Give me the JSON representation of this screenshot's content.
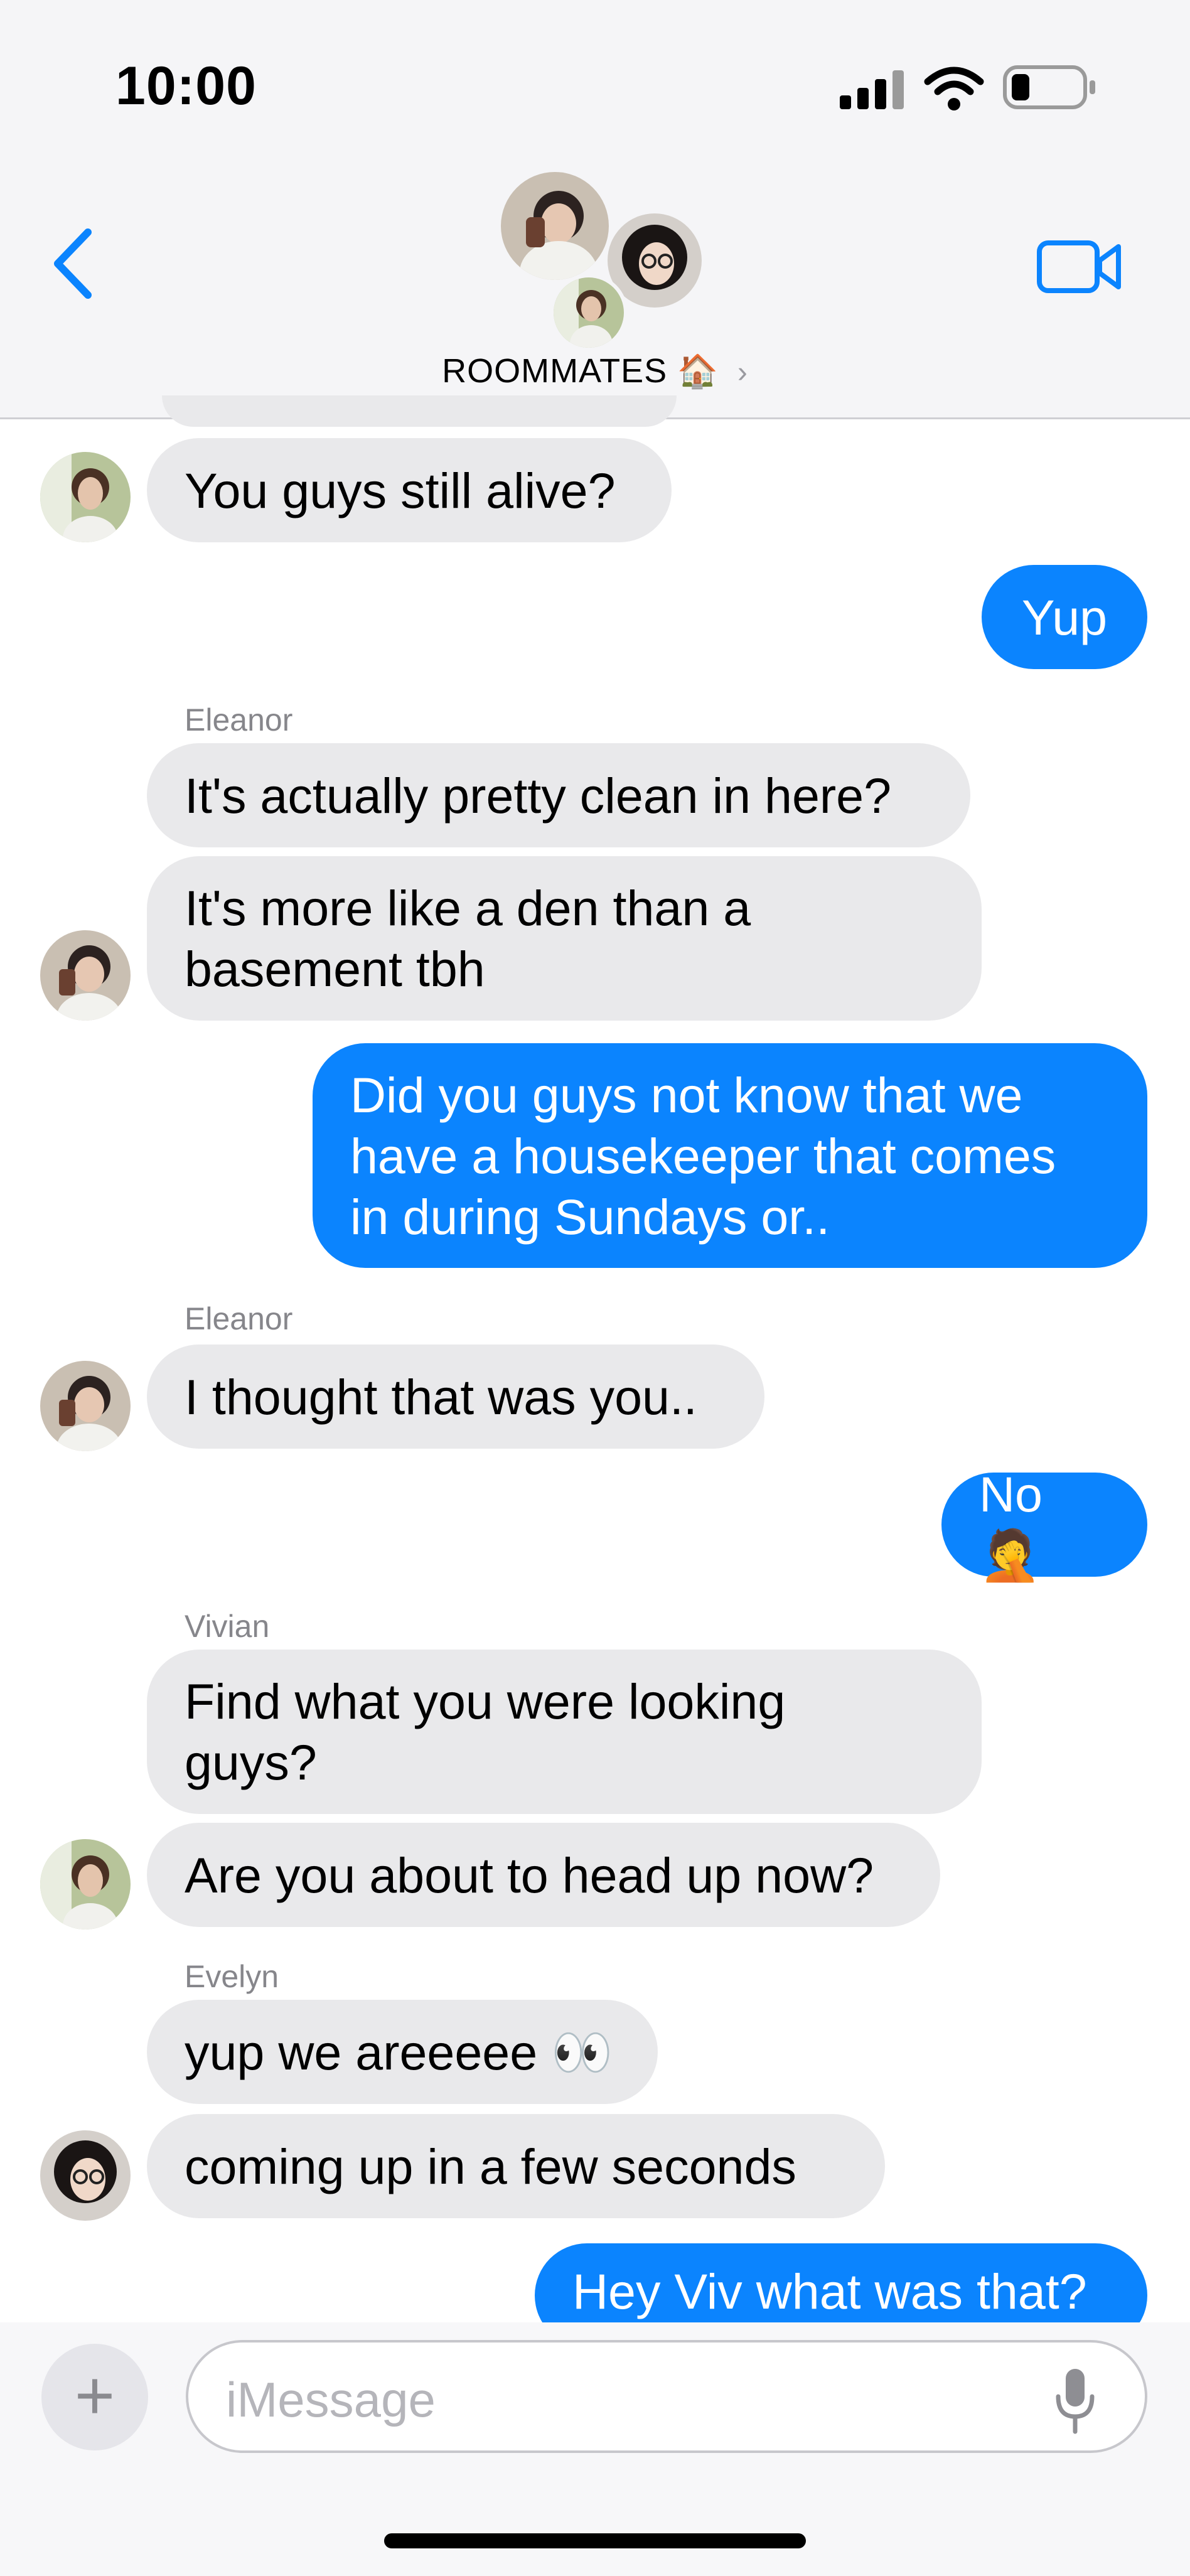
{
  "status_bar": {
    "time": "10:00"
  },
  "header": {
    "group_name": "ROOMMATES",
    "group_emoji": "🏠",
    "chevron": "›"
  },
  "icons": {
    "back": "chevron-left-icon",
    "video": "video-camera-icon",
    "signal": "signal-icon",
    "wifi": "wifi-icon",
    "battery": "battery-icon",
    "mic": "microphone-icon",
    "plus": "plus-icon"
  },
  "colors": {
    "accent": "#0b84fe",
    "incoming_bubble": "#e9e9eb",
    "header_bg": "#f5f5f7"
  },
  "messages": [
    {
      "direction": "in",
      "lines": [
        "You guys still alive?"
      ]
    },
    {
      "direction": "out",
      "lines": [
        "Yup"
      ]
    },
    {
      "sender": "Eleanor"
    },
    {
      "direction": "in",
      "lines": [
        "It's actually pretty clean in here?"
      ]
    },
    {
      "direction": "in",
      "lines": [
        "It's more like a den than a",
        "basement tbh"
      ]
    },
    {
      "direction": "out",
      "lines": [
        "Did you guys not know that we",
        "have a housekeeper that comes",
        "in during Sundays or.."
      ]
    },
    {
      "sender": "Eleanor"
    },
    {
      "direction": "in",
      "lines": [
        "I thought that was you.."
      ]
    },
    {
      "direction": "out",
      "lines": [
        "No 🤦"
      ]
    },
    {
      "sender": "Vivian"
    },
    {
      "direction": "in",
      "lines": [
        "Find what you were looking",
        "guys?"
      ]
    },
    {
      "direction": "in",
      "lines": [
        "Are you about to head up now?"
      ]
    },
    {
      "sender": "Evelyn"
    },
    {
      "direction": "in",
      "lines": [
        "yup we areeeee 👀"
      ]
    },
    {
      "direction": "in",
      "lines": [
        "coming up in a few seconds"
      ]
    },
    {
      "direction": "out",
      "lines": [
        "Hey Viv what was that?"
      ]
    }
  ],
  "composer": {
    "plus_label": "+",
    "placeholder": "iMessage"
  }
}
